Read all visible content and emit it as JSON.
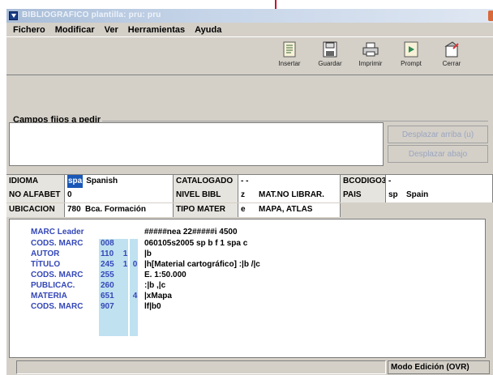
{
  "window": {
    "title": "BIBLIOGRAFICO plantilla: pru: pru"
  },
  "menu": [
    "Fichero",
    "Modificar",
    "Ver",
    "Herramientas",
    "Ayuda"
  ],
  "toolbar": [
    {
      "label": "Insertar",
      "icon": "insert-icon"
    },
    {
      "label": "Guardar",
      "icon": "save-icon"
    },
    {
      "label": "Imprimir",
      "icon": "print-icon"
    },
    {
      "label": "Prompt",
      "icon": "prompt-icon"
    },
    {
      "label": "Cerrar",
      "icon": "close-door-icon"
    }
  ],
  "fixed_fields": {
    "label": "Campos fijos a pedir",
    "move_up": "Desplazar arriba (u)",
    "move_down": "Desplazar abajo"
  },
  "grid": {
    "row1": {
      "idioma_label": "IDIOMA",
      "idioma_code": "spa",
      "idioma_value": "Spanish",
      "catalogado_label": "CATALOGADO",
      "catalogado_value": "- -",
      "bcodigo_label": "BCODIGO3",
      "bcodigo_value": "-"
    },
    "row2": {
      "alfabet_label": "NO ALFABET",
      "alfabet_value": "0",
      "nivel_label": "NIVEL BIBL",
      "nivel_code": "z",
      "nivel_value": "MAT.NO LIBRAR.",
      "pais_label": "PAIS",
      "pais_code": "sp",
      "pais_value": "Spain"
    },
    "row3": {
      "ubicacion_label": "UBICACION",
      "ubicacion_code": "780",
      "ubicacion_value": "Bca. Formación",
      "tipo_label": "TIPO MATER",
      "tipo_code": "e",
      "tipo_value": "MAPA, ATLAS"
    }
  },
  "marc": {
    "leader_label": "MARC Leader",
    "leader_value": "#####nea  22#####i 4500",
    "rows": [
      {
        "label": "CODS. MARC",
        "tag": "008",
        "ind1": "",
        "ind2": "",
        "value": "060105s2005   sp      b  f  1   spa c"
      },
      {
        "label": "AUTOR",
        "tag": "110",
        "ind1": "1",
        "ind2": "",
        "value": "|b"
      },
      {
        "label": "TÍTULO",
        "tag": "245",
        "ind1": "1",
        "ind2": "0",
        "value": "|h[Material cartográfico] :|b /|c"
      },
      {
        "label": "CODS. MARC",
        "tag": "255",
        "ind1": "",
        "ind2": "",
        "value": "E. 1:50.000"
      },
      {
        "label": "PUBLICAC.",
        "tag": "260",
        "ind1": "",
        "ind2": "",
        "value": ":|b ,|c"
      },
      {
        "label": "MATERIA",
        "tag": "651",
        "ind1": "",
        "ind2": "4",
        "value": "|xMapa"
      },
      {
        "label": "CODS. MARC",
        "tag": "907",
        "ind1": "",
        "ind2": "",
        "value": "lf|b0"
      }
    ]
  },
  "status": {
    "mode": "Modo Edición (OVR)"
  },
  "colors": {
    "accent_blue": "#3447b8",
    "tag_bg": "#bfe1f0",
    "title_red_mark": "#c8102e"
  }
}
